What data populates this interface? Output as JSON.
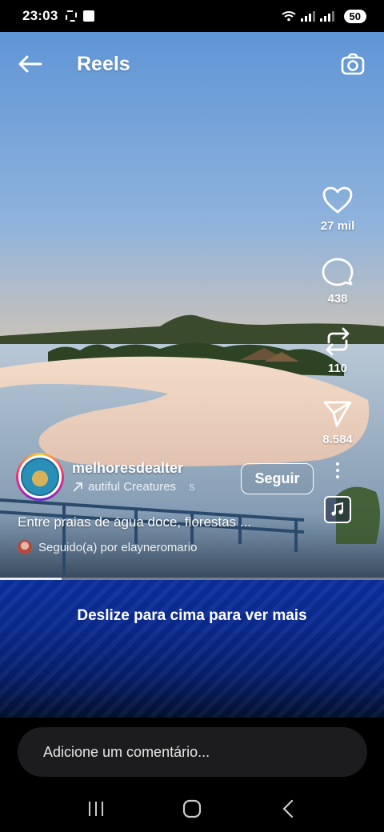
{
  "status_bar": {
    "time": "23:03",
    "battery": "50"
  },
  "header": {
    "title": "Reels",
    "back_icon": "back-arrow-icon",
    "camera_icon": "camera-icon"
  },
  "actions": [
    {
      "name": "like",
      "icon": "heart-icon",
      "count": "27 mil"
    },
    {
      "name": "comment",
      "icon": "comment-icon",
      "count": "438"
    },
    {
      "name": "repost",
      "icon": "repost-icon",
      "count": "110"
    },
    {
      "name": "share",
      "icon": "send-icon",
      "count": "8.584"
    }
  ],
  "author": {
    "username": "melhoresdealter",
    "audio": "autiful Creatures",
    "audio_overflow": "s",
    "follow_label": "Seguir"
  },
  "caption": "Entre praias de água doce, florestas ...",
  "followed_by": "Seguido(a) por elayneromario",
  "progress": 0.16,
  "swipe_banner": "Deslize para cima para ver mais",
  "comment_placeholder": "Adicione um comentário...",
  "colors": {
    "banner_blue": "#0a2f9e",
    "input_bg": "#1c1c1e"
  }
}
